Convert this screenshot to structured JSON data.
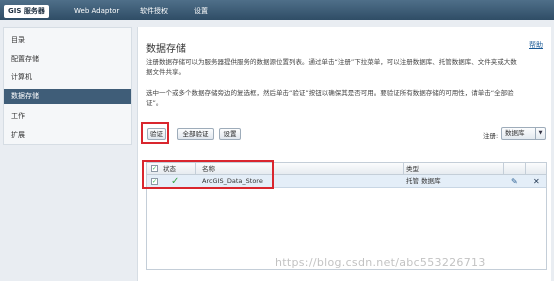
{
  "topbar": {
    "tabs": [
      {
        "label": "GIS 服务器"
      },
      {
        "label": "Web Adaptor"
      },
      {
        "label": "软件授权"
      },
      {
        "label": "设置"
      }
    ]
  },
  "sidebar": {
    "items": [
      {
        "label": "目录"
      },
      {
        "label": "配置存储"
      },
      {
        "label": "计算机"
      },
      {
        "label": "数据存储"
      },
      {
        "label": "工作"
      },
      {
        "label": "扩展"
      }
    ]
  },
  "main": {
    "title": "数据存储",
    "help_label": "帮助",
    "description_line1": "注册数据存储可以为服务器提供服务的数据源位置列表。通过单击“注册”下拉菜单，可以注册数据库、托管数据库、文件夹或大数",
    "description_line2": "据文件共享。",
    "instruction_line1": "选中一个或多个数据存储旁边的复选框，然后单击“验证”按钮以确保其是否可用。要验证所有数据存储的可用性，请单击“全部验",
    "instruction_line2": "证”。",
    "buttons": {
      "validate": "验证",
      "validate_all": "全部验证",
      "settings": "设置"
    },
    "register_label": "注册:",
    "register_select": "数据库",
    "table": {
      "headers": {
        "status": "状态",
        "name": "名称",
        "type": "类型"
      },
      "rows": [
        {
          "status_icon": "checkmark-icon",
          "status_symbol": "✓",
          "name": "ArcGIS_Data_Store",
          "type": "托管 数据库",
          "edit_symbol": "✎",
          "delete_symbol": "✕"
        }
      ]
    }
  },
  "watermark": "https://blog.csdn.net/abc553226713",
  "colors": {
    "topbar": "#2f4d66",
    "nav_active": "#3f5d78",
    "highlight_box": "#d9262e",
    "row_selected": "#e4eef8",
    "link": "#1a5a96",
    "status_ok": "#3aa34a"
  }
}
